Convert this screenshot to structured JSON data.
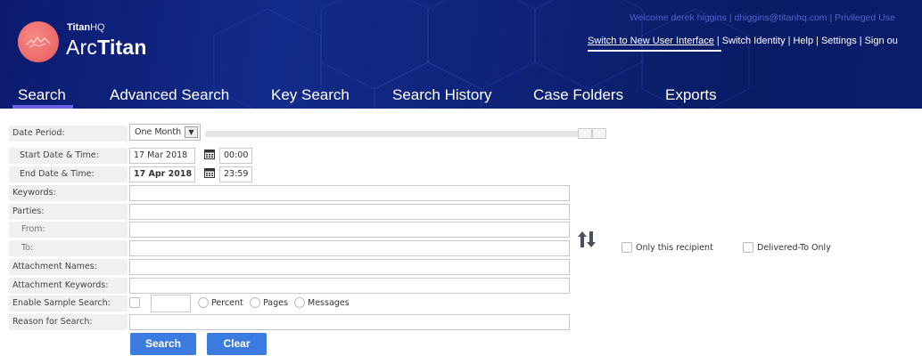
{
  "brand": {
    "small_a": "Titan",
    "small_b": "HQ",
    "big_a": "Arc",
    "big_b": "Titan"
  },
  "header": {
    "welcome": "Welcome derek higgins | dhiggins@titanhq.com | Privileged Use",
    "switch_ui": "Switch to New User Interface",
    "switch_identity": "Switch Identity",
    "help": "Help",
    "settings": "Settings",
    "sign_out": "Sign ou",
    "sep": "|"
  },
  "nav": {
    "search": "Search",
    "advanced": "Advanced Search",
    "key": "Key Search",
    "history": "Search History",
    "case": "Case Folders",
    "exports": "Exports",
    "active": "Search"
  },
  "form": {
    "date_period_label": "Date Period:",
    "date_period_value": "One Month",
    "start_label": "Start Date & Time:",
    "start_date": "17 Mar 2018",
    "start_time": "00:00",
    "end_label": "End Date & Time:",
    "end_date": "17 Apr 2018",
    "end_time": "23:59",
    "keywords_label": "Keywords:",
    "parties_label": "Parties:",
    "from_label": "From:",
    "to_label": "To:",
    "attach_names_label": "Attachment Names:",
    "attach_keywords_label": "Attachment Keywords:",
    "sample_label": "Enable Sample Search:",
    "percent": "Percent",
    "pages": "Pages",
    "messages": "Messages",
    "reason_label": "Reason for Search:",
    "only_recipient": "Only this recipient",
    "delivered_to": "Delivered-To Only"
  },
  "buttons": {
    "search": "Search",
    "clear": "Clear"
  },
  "colors": {
    "header_bg": "#0e2378",
    "accent": "#3c7ce0",
    "logo": "#ee6c6c",
    "active_tab": "#6a5fe0"
  }
}
